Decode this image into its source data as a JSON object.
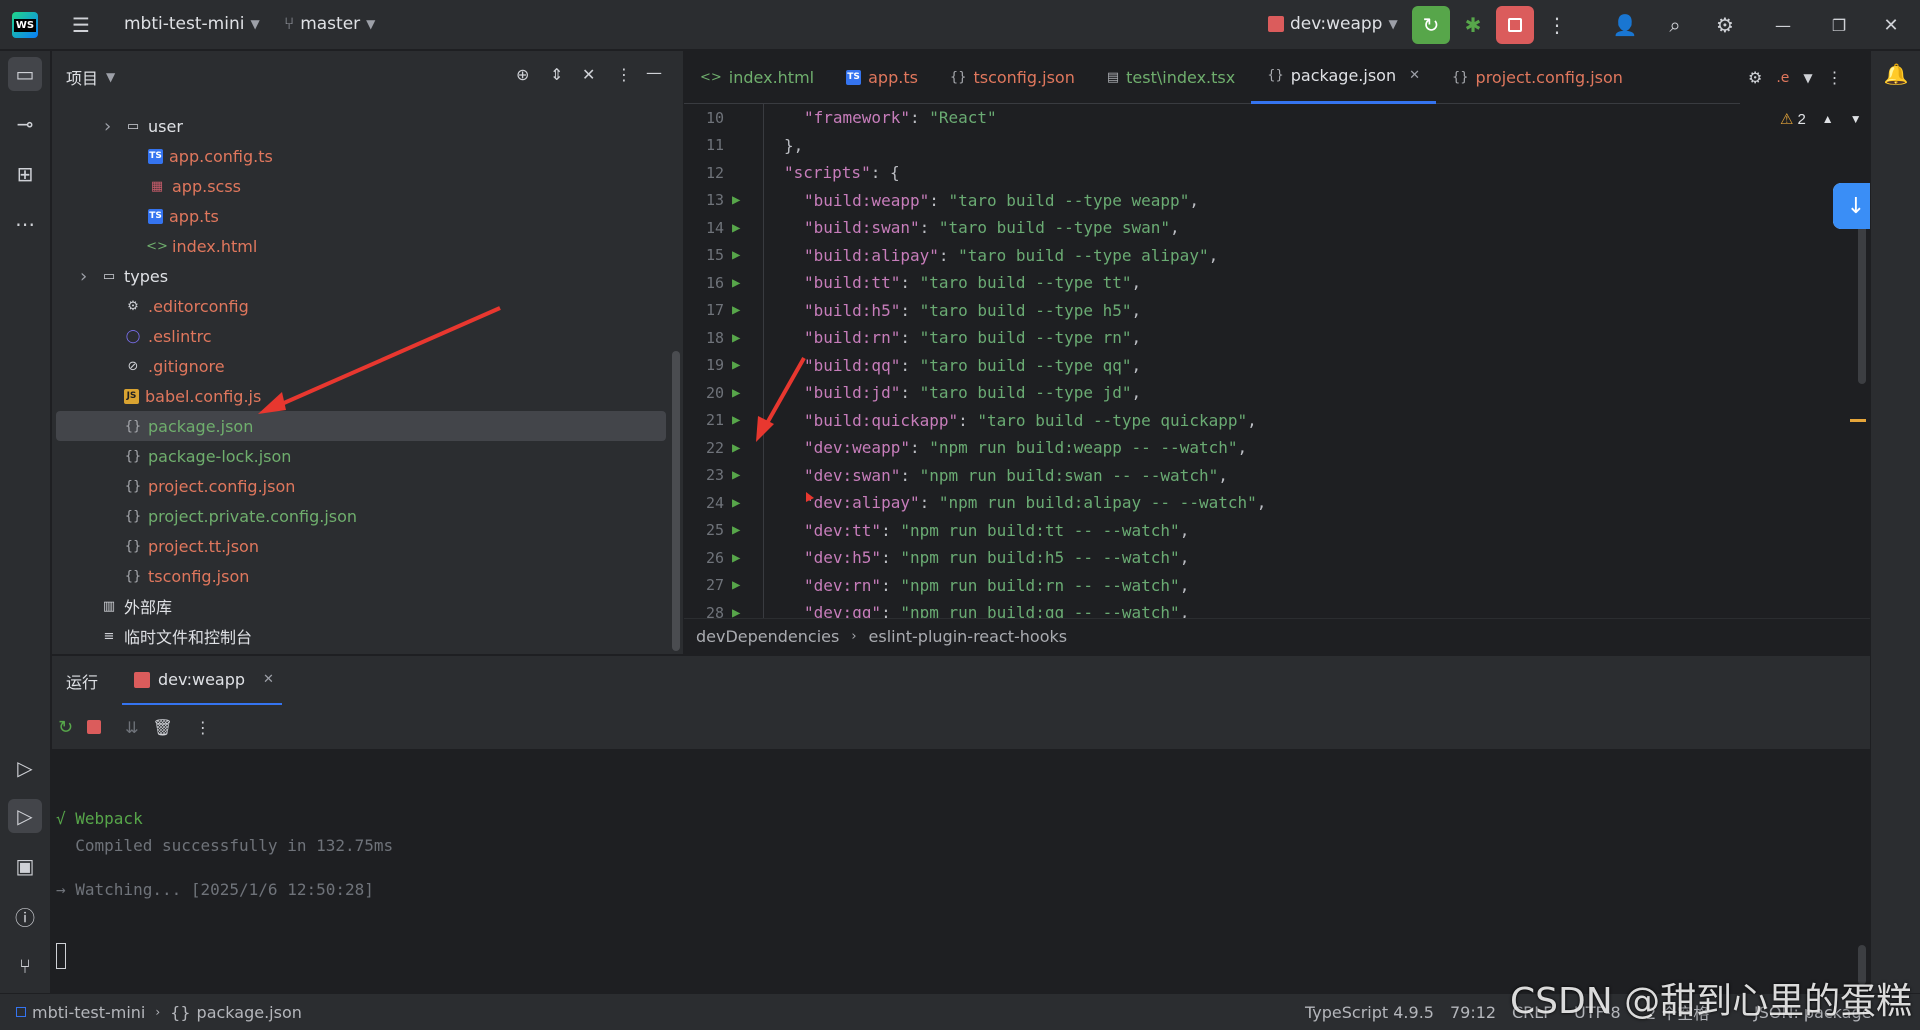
{
  "titlebar": {
    "project_name": "mbti-test-mini",
    "branch": "master",
    "run_config": "dev:weapp"
  },
  "project_panel": {
    "title": "项目",
    "tree": [
      {
        "label": "user",
        "type": "folder",
        "indent": 3,
        "color": "white"
      },
      {
        "label": "app.config.ts",
        "type": "ts",
        "indent": 4,
        "color": "red"
      },
      {
        "label": "app.scss",
        "type": "scss",
        "indent": 4,
        "color": "red"
      },
      {
        "label": "app.ts",
        "type": "ts",
        "indent": 4,
        "color": "red"
      },
      {
        "label": "index.html",
        "type": "html",
        "indent": 4,
        "color": "red"
      },
      {
        "label": "types",
        "type": "folder",
        "indent": 2,
        "color": "white"
      },
      {
        "label": ".editorconfig",
        "type": "gear",
        "indent": 3,
        "color": "red"
      },
      {
        "label": ".eslintrc",
        "type": "circle",
        "indent": 3,
        "color": "red"
      },
      {
        "label": ".gitignore",
        "type": "ban",
        "indent": 3,
        "color": "red"
      },
      {
        "label": "babel.config.js",
        "type": "js",
        "indent": 3,
        "color": "red"
      },
      {
        "label": "package.json",
        "type": "json",
        "indent": 3,
        "color": "green",
        "selected": true
      },
      {
        "label": "package-lock.json",
        "type": "json",
        "indent": 3,
        "color": "green"
      },
      {
        "label": "project.config.json",
        "type": "json",
        "indent": 3,
        "color": "red"
      },
      {
        "label": "project.private.config.json",
        "type": "json",
        "indent": 3,
        "color": "green"
      },
      {
        "label": "project.tt.json",
        "type": "json",
        "indent": 3,
        "color": "red"
      },
      {
        "label": "tsconfig.json",
        "type": "json",
        "indent": 3,
        "color": "red"
      },
      {
        "label": "外部库",
        "type": "lib",
        "indent": 2,
        "color": "white"
      },
      {
        "label": "临时文件和控制台",
        "type": "scratch",
        "indent": 2,
        "color": "white"
      }
    ]
  },
  "tabs": [
    {
      "label": "index.html",
      "type": "html",
      "color": "green"
    },
    {
      "label": "app.ts",
      "type": "ts",
      "color": "red"
    },
    {
      "label": "tsconfig.json",
      "type": "json",
      "color": "red"
    },
    {
      "label": "test\\index.tsx",
      "type": "tsx",
      "color": "green"
    },
    {
      "label": "package.json",
      "type": "json",
      "color": "white",
      "active": true
    },
    {
      "label": "project.config.json",
      "type": "json",
      "color": "red"
    }
  ],
  "tab_overflow": ".e",
  "warnings_count": "2",
  "editor_lines": [
    {
      "n": "10",
      "run": false,
      "indent": 1,
      "key": "\"framework\"",
      "sep": ": ",
      "val": "\"React\"",
      "end": ""
    },
    {
      "n": "11",
      "run": false,
      "indent": 0,
      "key": "",
      "sep": "",
      "val": "",
      "end": "},"
    },
    {
      "n": "12",
      "run": false,
      "indent": 0,
      "key": "\"scripts\"",
      "sep": ": ",
      "val": "",
      "end": "{"
    },
    {
      "n": "13",
      "run": true,
      "indent": 1,
      "key": "\"build:weapp\"",
      "sep": ": ",
      "val": "\"taro build --type weapp\"",
      "end": ","
    },
    {
      "n": "14",
      "run": true,
      "indent": 1,
      "key": "\"build:swan\"",
      "sep": ": ",
      "val": "\"taro build --type swan\"",
      "end": ","
    },
    {
      "n": "15",
      "run": true,
      "indent": 1,
      "key": "\"build:alipay\"",
      "sep": ": ",
      "val": "\"taro build --type alipay\"",
      "end": ","
    },
    {
      "n": "16",
      "run": true,
      "indent": 1,
      "key": "\"build:tt\"",
      "sep": ": ",
      "val": "\"taro build --type tt\"",
      "end": ","
    },
    {
      "n": "17",
      "run": true,
      "indent": 1,
      "key": "\"build:h5\"",
      "sep": ": ",
      "val": "\"taro build --type h5\"",
      "end": ","
    },
    {
      "n": "18",
      "run": true,
      "indent": 1,
      "key": "\"build:rn\"",
      "sep": ": ",
      "val": "\"taro build --type rn\"",
      "end": ","
    },
    {
      "n": "19",
      "run": true,
      "indent": 1,
      "key": "\"build:qq\"",
      "sep": ": ",
      "val": "\"taro build --type qq\"",
      "end": ","
    },
    {
      "n": "20",
      "run": true,
      "indent": 1,
      "key": "\"build:jd\"",
      "sep": ": ",
      "val": "\"taro build --type jd\"",
      "end": ","
    },
    {
      "n": "21",
      "run": true,
      "indent": 1,
      "key": "\"build:quickapp\"",
      "sep": ": ",
      "val": "\"taro build --type quickapp\"",
      "end": ","
    },
    {
      "n": "22",
      "run": true,
      "indent": 1,
      "key": "\"dev:weapp\"",
      "sep": ": ",
      "val": "\"npm run build:weapp -- --watch\"",
      "end": ","
    },
    {
      "n": "23",
      "run": true,
      "indent": 1,
      "key": "\"dev:swan\"",
      "sep": ": ",
      "val": "\"npm run build:swan -- --watch\"",
      "end": ","
    },
    {
      "n": "24",
      "run": true,
      "indent": 1,
      "key": "\"dev:alipay\"",
      "sep": ": ",
      "val": "\"npm run build:alipay -- --watch\"",
      "end": ","
    },
    {
      "n": "25",
      "run": true,
      "indent": 1,
      "key": "\"dev:tt\"",
      "sep": ": ",
      "val": "\"npm run build:tt -- --watch\"",
      "end": ","
    },
    {
      "n": "26",
      "run": true,
      "indent": 1,
      "key": "\"dev:h5\"",
      "sep": ": ",
      "val": "\"npm run build:h5 -- --watch\"",
      "end": ","
    },
    {
      "n": "27",
      "run": true,
      "indent": 1,
      "key": "\"dev:rn\"",
      "sep": ": ",
      "val": "\"npm run build:rn -- --watch\"",
      "end": ","
    },
    {
      "n": "28",
      "run": true,
      "indent": 1,
      "key": "\"dev:qq\"",
      "sep": ": ",
      "val": "\"npm run build:qq -- --watch\"",
      "end": ","
    }
  ],
  "breadcrumb": [
    "devDependencies",
    "eslint-plugin-react-hooks"
  ],
  "run_panel": {
    "title": "运行",
    "tab_label": "dev:weapp",
    "console": {
      "webpack": "√ Webpack",
      "compiled": "  Compiled successfully in 132.75ms",
      "watching": "→ Watching... [2025/1/6 12:50:28]"
    }
  },
  "status": {
    "project": "mbti-test-mini",
    "file": "package.json",
    "language": "TypeScript 4.9.5",
    "position": "79:12",
    "line_sep": "CRLF",
    "encoding": "UTF-8",
    "indent": "2 个空格",
    "schema": "JSON: package"
  },
  "watermark": "CSDN @甜到心里的蛋糕",
  "colors": {
    "accent": "#3574f0",
    "run_green": "#57a64a",
    "stop_red": "#db5c5c",
    "annotation_red": "#e8372f"
  }
}
